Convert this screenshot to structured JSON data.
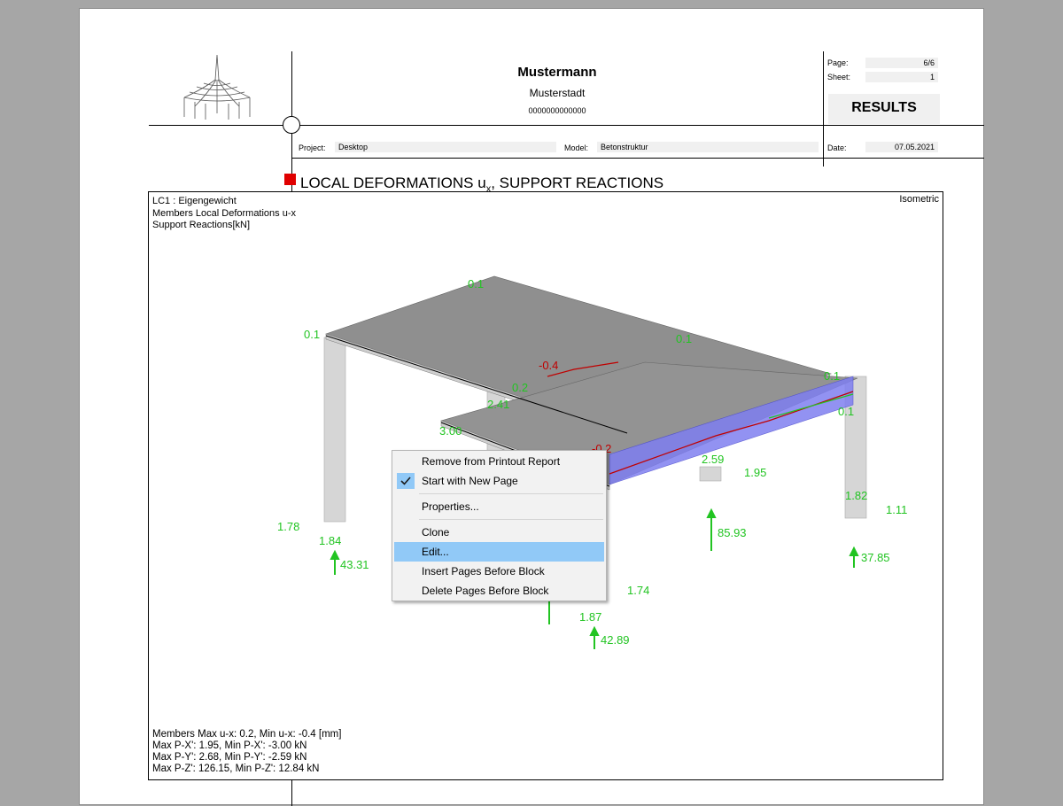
{
  "header": {
    "company_name": "Mustermann",
    "company_city": "Musterstadt",
    "company_number": "0000000000000",
    "page_label": "Page:",
    "page_value": "6/6",
    "sheet_label": "Sheet:",
    "sheet_value": "1",
    "results_label": "RESULTS",
    "project_label": "Project:",
    "project_value": "Desktop",
    "model_label": "Model:",
    "model_value": "Betonstruktur",
    "date_label": "Date:",
    "date_value": "07.05.2021"
  },
  "section": {
    "title_main": "LOCAL DEFORMATIONS u",
    "title_sub": "x",
    "title_rest": ", SUPPORT REACTIONS"
  },
  "view": {
    "line1": "LC1 : Eigengewicht",
    "line2": "Members Local Deformations u-x",
    "line3": "Support Reactions[kN]",
    "projection": "Isometric",
    "summary1": "Members Max u-x: 0.2, Min u-x: -0.4 [mm]",
    "summary2": "Max P-X': 1.95, Min P-X': -3.00 kN",
    "summary3": "Max P-Y': 2.68, Min P-Y': -2.59 kN",
    "summary4": "Max P-Z': 126.15, Min P-Z': 12.84 kN"
  },
  "labels": {
    "deform_top": "0.1",
    "deform_left": "0.1",
    "deform_mid": "0.2",
    "deform_right1": "0.1",
    "deform_right2": "0.1",
    "deform_min": "-0.4",
    "deform_low": "-0.2",
    "deform_mid2": "0.2",
    "support_a_x": "1.78",
    "support_a_y": "1.84",
    "support_a_z": "43.31",
    "support_b_x": "3.00",
    "support_b_y": "2.41",
    "support_c_x": "2.59",
    "support_c_y": "1.95",
    "support_c_z": "85.93",
    "support_d_x": "1.82",
    "support_d_y": "1.11",
    "support_d_z": "37.85",
    "support_e_x": "1.74",
    "support_e_y": "1.87",
    "support_e_z": "42.89"
  },
  "context_menu": {
    "items": [
      {
        "label": "Remove from Printout Report"
      },
      {
        "label": "Start with New Page"
      },
      {
        "label": "Properties..."
      },
      {
        "label": "Clone"
      },
      {
        "label": "Edit..."
      },
      {
        "label": "Insert Pages Before Block"
      },
      {
        "label": "Delete Pages Before Block"
      }
    ]
  },
  "colors": {
    "deformation_green": "#22c422",
    "deformation_red": "#c00000",
    "section_marker": "#e00000",
    "menu_highlight": "#91c9f7",
    "slab_gray": "#8f8f8f",
    "beam_blue": "#7f7ff0"
  }
}
